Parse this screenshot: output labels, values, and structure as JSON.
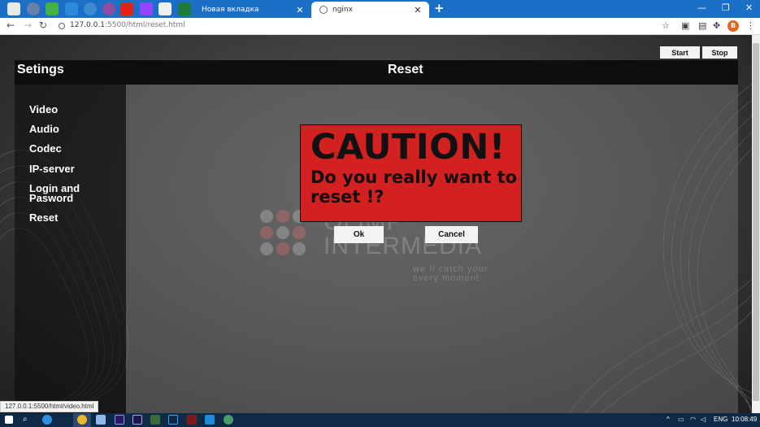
{
  "browser": {
    "tabs": [
      {
        "title": "Новая вкладка",
        "active": false
      },
      {
        "title": "nginx",
        "active": true
      }
    ],
    "url_host": "127.0.0.1",
    "url_path": ":5500/html/reset.html",
    "profile_initial": "B"
  },
  "header": {
    "title_left": "Setings",
    "title_center": "Reset",
    "start_label": "Start",
    "stop_label": "Stop"
  },
  "sidebar": {
    "items": [
      {
        "label": "Video"
      },
      {
        "label": "Audio"
      },
      {
        "label": "Codec"
      },
      {
        "label": "IP-server"
      },
      {
        "label": "Login and Pasword"
      },
      {
        "label": "Reset"
      }
    ]
  },
  "dialog": {
    "heading": "CAUTION!",
    "question": "Do you really want to reset !?",
    "ok_label": "Ok",
    "cancel_label": "Cancel",
    "box_color": "#d32020"
  },
  "watermark": {
    "line1": "OLIMP",
    "line2": "INTERMEDIA",
    "tagline": "we`ll catch your every moment"
  },
  "status_tip": "127.0.0.1:5500/html/video.html",
  "taskbar": {
    "language": "ENG",
    "time": "10:08:49"
  }
}
